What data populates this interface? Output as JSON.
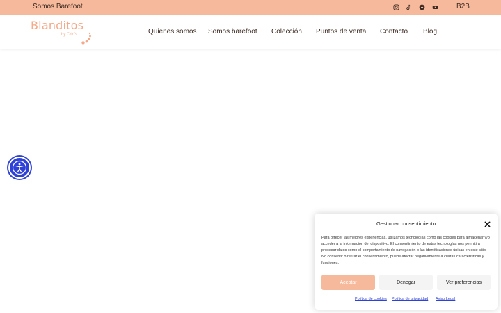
{
  "topbar": {
    "left_text": "Somos Barefoot",
    "social_icons": [
      "instagram-icon",
      "tiktok-icon",
      "facebook-icon",
      "youtube-icon"
    ],
    "b2b_label": "B2B"
  },
  "logo": {
    "main": "Blanditos",
    "sub": "by Crio's"
  },
  "nav": {
    "items": [
      "Quienes somos",
      "Somos barefoot",
      "Colección",
      "Puntos de venta",
      "Contacto",
      "Blog"
    ]
  },
  "consent": {
    "title": "Gestionar consentimiento",
    "body": "Para ofrecer las mejores experiencias, utilizamos tecnologías como las cookies para almacenar y/o acceder a la información del dispositivo. El consentimiento de estas tecnologías nos permitirá procesar datos como el comportamiento de navegación o las identificaciones únicas en este sitio. No consentir o retirar el consentimiento, puede afectar negativamente a ciertas características y funciones.",
    "accept_label": "Aceptar",
    "deny_label": "Denegar",
    "prefs_label": "Ver preferencias",
    "links": [
      "Política de cookies",
      "Política de privacidad",
      "Aviso Legal"
    ]
  },
  "colors": {
    "accent": "#f7b99b",
    "logo": "#f4a98a",
    "a11y": "#2e42d8"
  }
}
